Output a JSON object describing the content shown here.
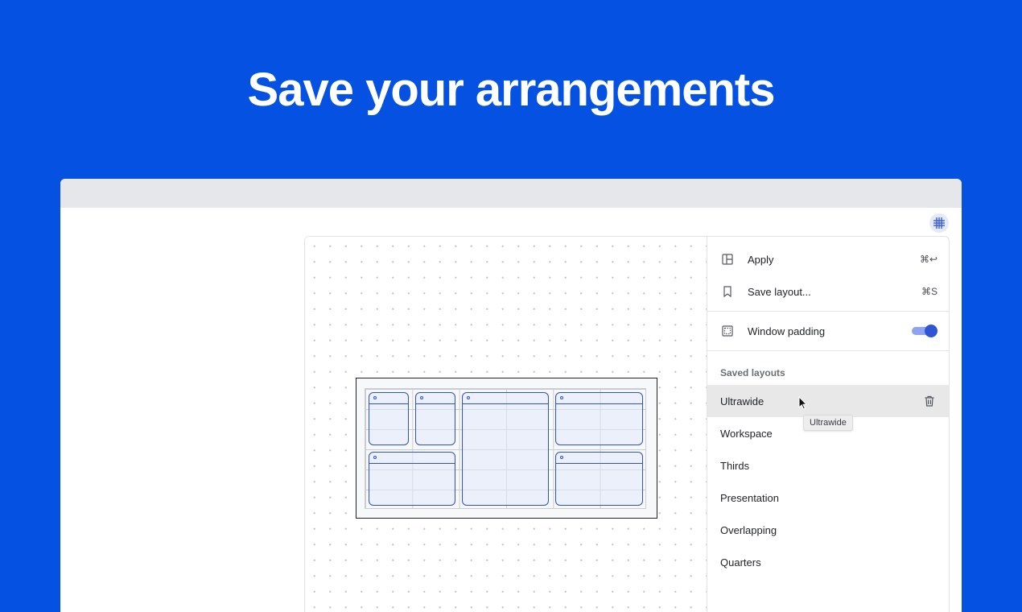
{
  "hero": {
    "title": "Save your arrangements"
  },
  "colors": {
    "background": "#0551E2",
    "accent": "#2F55D4",
    "window_outline": "#2E52C9"
  },
  "toolbar": {
    "grid_button_icon": "grid-icon"
  },
  "menu": {
    "apply": {
      "label": "Apply",
      "shortcut": "⌘↩",
      "icon": "layout-icon"
    },
    "save_layout": {
      "label": "Save layout...",
      "shortcut": "⌘S",
      "icon": "bookmark-icon"
    },
    "window_padding": {
      "label": "Window padding",
      "enabled": true,
      "icon": "padding-icon"
    }
  },
  "saved_layouts": {
    "heading": "Saved layouts",
    "items": [
      {
        "name": "Ultrawide",
        "active": true
      },
      {
        "name": "Workspace"
      },
      {
        "name": "Thirds"
      },
      {
        "name": "Presentation"
      },
      {
        "name": "Overlapping"
      },
      {
        "name": "Quarters"
      }
    ],
    "tooltip": "Ultrawide",
    "delete_icon": "trash-icon"
  }
}
